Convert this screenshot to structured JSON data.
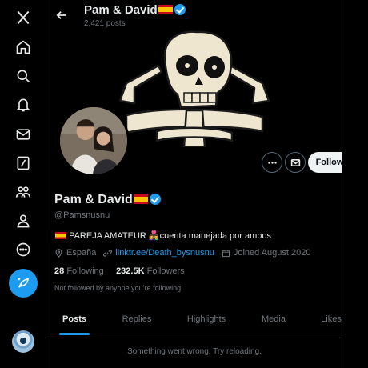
{
  "nav": {
    "items": [
      {
        "name": "x-logo-icon"
      },
      {
        "name": "home-icon"
      },
      {
        "name": "search-icon"
      },
      {
        "name": "notifications-icon"
      },
      {
        "name": "messages-icon"
      },
      {
        "name": "grok-icon"
      },
      {
        "name": "communities-icon"
      },
      {
        "name": "profile-icon"
      },
      {
        "name": "more-icon"
      }
    ],
    "compose_icon": "compose-feather-icon"
  },
  "header": {
    "name": "Pam & David",
    "post_count": "2,421 posts"
  },
  "profile": {
    "name": "Pam & David",
    "handle": "@Pamsnusnu",
    "bio_text": "PAREJA AMATEUR ",
    "bio_emoji": "👩‍❤️‍👨",
    "bio_rest": "cuenta manejada por ambos",
    "location": "España",
    "link": "linktr.ee/Death_bysnusnu",
    "joined": "Joined August 2020",
    "following_count": "28",
    "following_label": "Following",
    "followers_count": "232.5K",
    "followers_label": "Followers",
    "not_followed": "Not followed by anyone you’re following"
  },
  "actions": {
    "follow_label": "Follow"
  },
  "tabs": [
    {
      "label": "Posts",
      "active": true
    },
    {
      "label": "Replies"
    },
    {
      "label": "Highlights"
    },
    {
      "label": "Media"
    },
    {
      "label": "Likes"
    }
  ],
  "error_text": "Something went wrong. Try reloading.",
  "colors": {
    "accent": "#1d9bf0",
    "background": "#000000",
    "text": "#e7e9ea",
    "muted": "#71767b"
  }
}
